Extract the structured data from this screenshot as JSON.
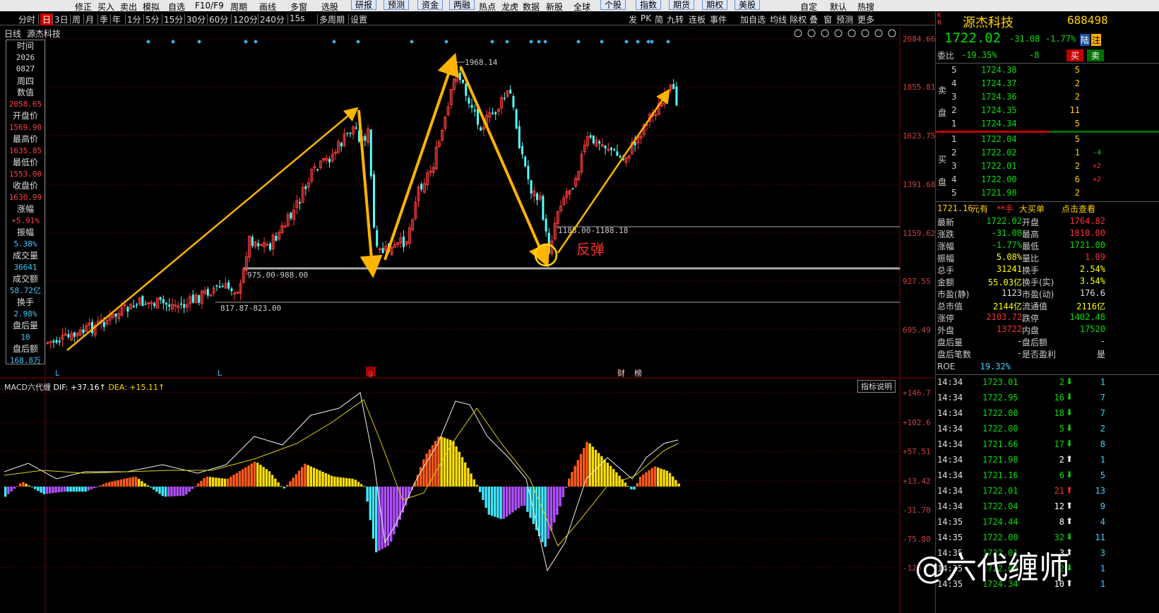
{
  "menubar": {
    "items": [
      "修正",
      "买入",
      "卖出",
      "模拟",
      "自选",
      "F10/F9",
      "周期",
      "画线",
      "多窗",
      "选股",
      "研报",
      "预测",
      "资金",
      "两融",
      "热点",
      "龙虎",
      "数据",
      "新股",
      "全球",
      "个股",
      "指数",
      "期货",
      "期权",
      "美股",
      "自定",
      "默认",
      "热搜"
    ]
  },
  "periodbar": {
    "items": [
      "分时",
      "日",
      "3日",
      "周",
      "月",
      "季",
      "年",
      "1分",
      "5分",
      "15分",
      "30分",
      "60分",
      "120分",
      "240分",
      "15s",
      "多周期",
      "设置"
    ],
    "active": "日",
    "right_items": [
      "发",
      "PK",
      "简",
      "九转",
      "连板",
      "事件",
      "加自选",
      "均线",
      "除权",
      "叠",
      "窗",
      "预测",
      "更多"
    ]
  },
  "chart": {
    "period_label": "日线",
    "stock_name": "源杰科技",
    "price_axis": [
      "2084.66",
      "1855.81",
      "1623.75",
      "1391.68",
      "1159.62",
      "927.55",
      "695.49"
    ],
    "macd_axis": [
      "+146.7",
      "+102.6",
      "+57.51",
      "+13.42",
      "-31.70",
      "-75.80",
      "-120"
    ],
    "annotations": {
      "high_label": "1968.14",
      "level1": "1188.00-1188.18",
      "level2": "975.00-988.00",
      "level3": "817.87-823.00",
      "rebound": "反弹"
    },
    "bottom_marks": [
      "L",
      "L",
      "g",
      "财",
      "榜"
    ]
  },
  "infobox": [
    {
      "k": "时间",
      "v": "2026",
      "c": "w"
    },
    {
      "k": "",
      "v": "0827",
      "c": "w"
    },
    {
      "k": "周四",
      "v": "",
      "c": "w"
    },
    {
      "k": "数值",
      "v": "2058.65",
      "c": "r"
    },
    {
      "k": "开盘价",
      "v": "1569.90",
      "c": "r"
    },
    {
      "k": "最高价",
      "v": "1635.85",
      "c": "r"
    },
    {
      "k": "最低价",
      "v": "1553.00",
      "c": "r"
    },
    {
      "k": "收盘价",
      "v": "1630.99",
      "c": "r"
    },
    {
      "k": "涨幅",
      "v": "+5.91%",
      "c": "r"
    },
    {
      "k": "振幅",
      "v": "5.38%",
      "c": "c"
    },
    {
      "k": "成交量",
      "v": "36641",
      "c": "c"
    },
    {
      "k": "成交额",
      "v": "58.72亿",
      "c": "c"
    },
    {
      "k": "换手",
      "v": "2.98%",
      "c": "c"
    },
    {
      "k": "盘后量",
      "v": "10",
      "c": "c"
    },
    {
      "k": "盘后额",
      "v": "168.8万",
      "c": "c"
    }
  ],
  "macd": {
    "name": "MACD六代缠",
    "dif": "DIF: +37.16↑",
    "dea": "DEA: +15.11↑",
    "explain": "指标说明"
  },
  "quote": {
    "name": "源杰科技",
    "code": "688498",
    "price": "1722.02",
    "change": "-31.08",
    "pct": "-1.77%",
    "tag1": "陆",
    "tag2": "注",
    "weibi_label": "委比",
    "weibi": "-19.35%",
    "weicha": "-8",
    "buy_btn": "买",
    "sell_btn": "卖",
    "sell_side_label": "卖盘",
    "buy_side_label": "买盘",
    "asks": [
      {
        "lvl": "5",
        "price": "1724.38",
        "vol": "5",
        "chg": ""
      },
      {
        "lvl": "4",
        "price": "1724.37",
        "vol": "2",
        "chg": ""
      },
      {
        "lvl": "3",
        "price": "1724.36",
        "vol": "2",
        "chg": ""
      },
      {
        "lvl": "2",
        "price": "1724.35",
        "vol": "11",
        "chg": ""
      },
      {
        "lvl": "1",
        "price": "1724.34",
        "vol": "5",
        "chg": ""
      }
    ],
    "bids": [
      {
        "lvl": "1",
        "price": "1722.04",
        "vol": "5",
        "chg": ""
      },
      {
        "lvl": "2",
        "price": "1722.02",
        "vol": "1",
        "chg": "-4"
      },
      {
        "lvl": "3",
        "price": "1722.01",
        "vol": "2",
        "chg": "+2"
      },
      {
        "lvl": "4",
        "price": "1722.00",
        "vol": "6",
        "chg": "+2"
      },
      {
        "lvl": "5",
        "price": "1721.98",
        "vol": "2",
        "chg": ""
      }
    ],
    "bigorder": {
      "price": "1721.16",
      "unit": "元有",
      "hand": "**手",
      "label": "大买单",
      "action": "点击查看"
    },
    "stats": [
      {
        "k1": "最新",
        "v1": "1722.02",
        "c1": "green",
        "k2": "开盘",
        "v2": "1764.82",
        "c2": "red"
      },
      {
        "k1": "涨跌",
        "v1": "-31.08",
        "c1": "green",
        "k2": "最高",
        "v2": "1810.00",
        "c2": "red"
      },
      {
        "k1": "涨幅",
        "v1": "-1.77%",
        "c1": "green",
        "k2": "最低",
        "v2": "1721.00",
        "c2": "green"
      },
      {
        "k1": "振幅",
        "v1": "5.08%",
        "c1": "yellow",
        "k2": "量比",
        "v2": "1.09",
        "c2": "red"
      },
      {
        "k1": "总手",
        "v1": "31241",
        "c1": "yellow",
        "k2": "换手",
        "v2": "2.54%",
        "c2": "yellow"
      },
      {
        "k1": "金额",
        "v1": "55.03亿",
        "c1": "yellow",
        "k2": "换手(实)",
        "v2": "3.54%",
        "c2": "yellow"
      },
      {
        "k1": "市盈(静)",
        "v1": "1123",
        "c1": "white",
        "k2": "市盈(动)",
        "v2": "176.6",
        "c2": "white"
      },
      {
        "k1": "总市值",
        "v1": "2144亿",
        "c1": "yellow",
        "k2": "流通值",
        "v2": "2116亿",
        "c2": "yellow"
      },
      {
        "k1": "涨停",
        "v1": "2103.72",
        "c1": "red",
        "k2": "跌停",
        "v2": "1402.48",
        "c2": "green"
      },
      {
        "k1": "外盘",
        "v1": "13722",
        "c1": "red",
        "k2": "内盘",
        "v2": "17520",
        "c2": "green"
      },
      {
        "k1": "盘后量",
        "v1": "-",
        "c1": "white",
        "k2": "盘后额",
        "v2": "-",
        "c2": "white"
      },
      {
        "k1": "盘后笔数",
        "v1": "-",
        "c1": "white",
        "k2": "是否盈利",
        "v2": "是",
        "c2": "white"
      }
    ],
    "roe_label": "ROE",
    "roe": "19.32%",
    "ticks": [
      {
        "t": "14:34",
        "p": "1723.01",
        "v": "2",
        "dir": "down",
        "n": "1"
      },
      {
        "t": "14:34",
        "p": "1722.95",
        "v": "16",
        "dir": "down",
        "n": "7"
      },
      {
        "t": "14:34",
        "p": "1722.00",
        "v": "18",
        "dir": "down",
        "n": "7"
      },
      {
        "t": "14:34",
        "p": "1722.00",
        "v": "5",
        "dir": "down",
        "n": "2"
      },
      {
        "t": "14:34",
        "p": "1721.66",
        "v": "17",
        "dir": "down",
        "n": "8"
      },
      {
        "t": "14:34",
        "p": "1721.98",
        "v": "2",
        "dir": "up",
        "n": "1"
      },
      {
        "t": "14:34",
        "p": "1721.16",
        "v": "6",
        "dir": "down",
        "n": "5"
      },
      {
        "t": "14:34",
        "p": "1722.01",
        "v": "21",
        "dir": "up",
        "n": "13"
      },
      {
        "t": "14:34",
        "p": "1722.04",
        "v": "12",
        "dir": "up",
        "n": "9"
      },
      {
        "t": "14:35",
        "p": "1724.44",
        "v": "8",
        "dir": "up",
        "n": "4"
      },
      {
        "t": "14:35",
        "p": "1722.00",
        "v": "32",
        "dir": "down",
        "n": "11"
      },
      {
        "t": "14:35",
        "p": "1722.01",
        "v": "3",
        "dir": "up",
        "n": "3"
      },
      {
        "t": "14:35",
        "p": "1722.00",
        "v": "2",
        "dir": "down",
        "n": "1"
      },
      {
        "t": "14:35",
        "p": "1724.34",
        "v": "10",
        "dir": "up",
        "n": "1"
      }
    ]
  },
  "watermark": "@六代缠师"
}
